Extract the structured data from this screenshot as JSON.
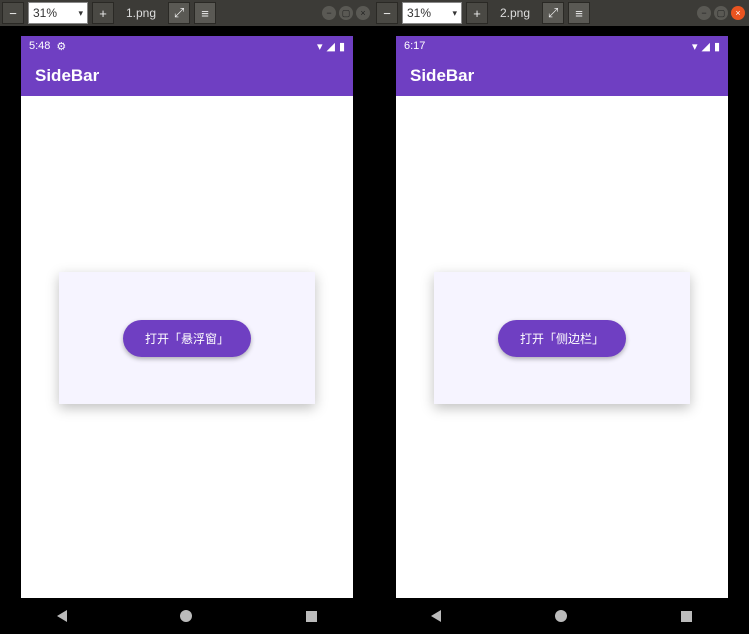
{
  "toolbar": {
    "zoom_minus": "−",
    "zoom_plus": "+",
    "zoom_value": "31%",
    "expand_glyph": "⤢",
    "menu_glyph": "≡"
  },
  "windows": [
    {
      "filename": "1.png",
      "phone": {
        "time": "5:48",
        "show_gear": true,
        "app_title": "SideBar",
        "button_label": "打开「悬浮窗」"
      }
    },
    {
      "filename": "2.png",
      "phone": {
        "time": "6:17",
        "show_gear": false,
        "app_title": "SideBar",
        "button_label": "打开「侧边栏」"
      }
    }
  ]
}
